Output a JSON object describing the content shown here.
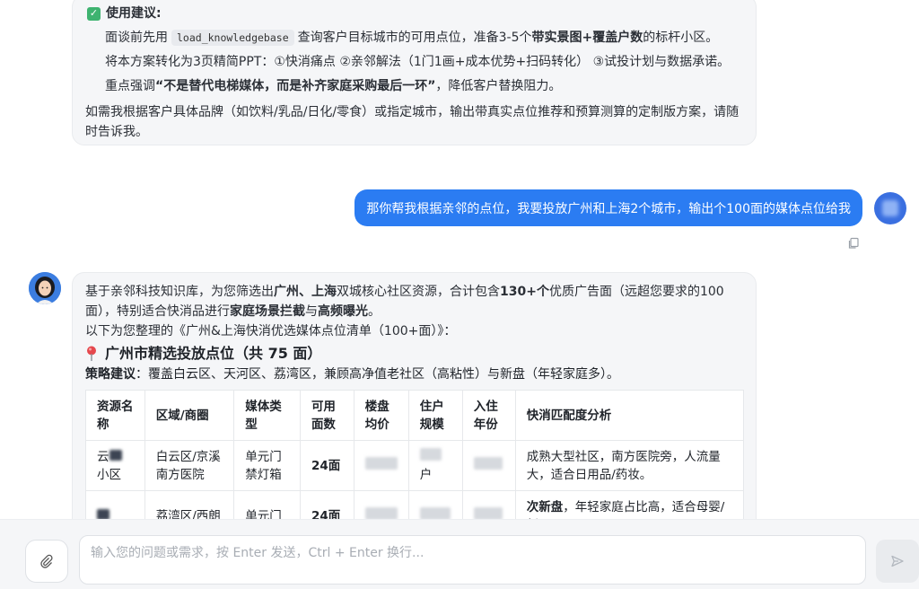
{
  "prev_answer": {
    "tip_title": "使用建议",
    "tip1_a": "面谈前先用",
    "tip1_code": "load_knowledgebase",
    "tip1_b": "查询客户目标城市的可用点位，准备3-5个",
    "tip1_bold": "带实景图+覆盖户数",
    "tip1_c": "的标杆小区。",
    "tip2": "将本方案转化为3页精简PPT：①快消痛点 ②亲邻解法（1门1画+成本优势+扫码转化） ③试投计划与数据承诺。",
    "tip3_a": "重点强调",
    "tip3_bold": "“不是替代电梯媒体，而是补齐家庭采购最后一环”",
    "tip3_b": "，降低客户替换阻力。",
    "closing": "如需我根据客户具体品牌（如饮料/乳品/日化/零食）或指定城市，输出带真实点位推荐和预算测算的定制版方案，请随时告诉我。"
  },
  "user_message": "那你帮我根据亲邻的点位，我要投放广州和上海2个城市，输出个100面的媒体点位给我",
  "answer": {
    "intro_a": "基于亲邻科技知识库，为您筛选出",
    "intro_bold1": "广州、上海",
    "intro_b": "双城核心社区资源，合计包含",
    "intro_bold2": "130+个",
    "intro_c": "优质广告面（远超您要求的100面），特别适合快消品进行",
    "intro_bold3": "家庭场景拦截",
    "intro_d": "与",
    "intro_bold4": "高频曝光",
    "intro_e": "。",
    "list_title": "以下为您整理的《广州&上海快消优选媒体点位清单（100+面）》：",
    "section_title": "广州市精选投放点位（共 75 面）",
    "strategy_label": "策略建议",
    "strategy_text": "：覆盖白云区、天河区、荔湾区，兼顾高净值老社区（高粘性）与新盘（年轻家庭多）。",
    "table": {
      "headers": [
        "资源名称",
        "区域/商圈",
        "媒体类型",
        "可用面数",
        "楼盘均价",
        "住户规模",
        "入住年份",
        "快消匹配度分析"
      ],
      "rows": [
        {
          "name_a": "云",
          "name_b": "小区",
          "area": "白云区/京溪南方医院",
          "media": "单元门禁灯箱",
          "count": "24面",
          "households_suffix": "户",
          "analysis_bold": "",
          "analysis": "成熟大型社区，南方医院旁，人流量大，适合日用品/药妆。"
        },
        {
          "name_a": "",
          "name_b": "",
          "area": "荔湾区/西朗",
          "media": "单元门",
          "count": "24面",
          "households_suffix": "",
          "analysis_bold": "次新盘",
          "analysis": "，年轻家庭占比高，适合母婴/新"
        }
      ]
    }
  },
  "composer": {
    "placeholder": "输入您的问题或需求，按 Enter 发送，Ctrl + Enter 换行..."
  },
  "colors": {
    "user_bubble": "#2b7cf2",
    "check_green": "#3eb370",
    "pin_red": "#e5484d"
  }
}
